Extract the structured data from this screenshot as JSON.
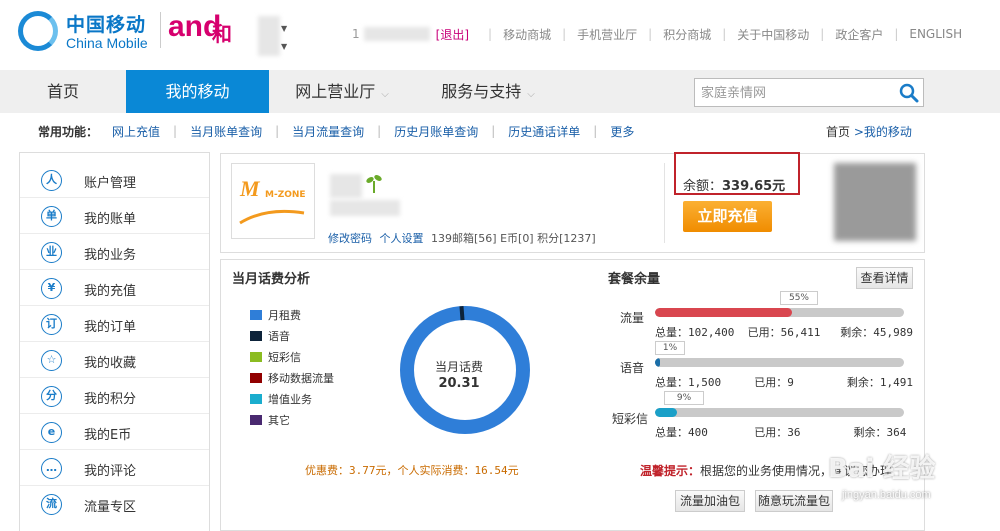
{
  "header": {
    "logo_cn": "中国移动",
    "logo_en": "China Mobile",
    "logo_and": "and",
    "logo_he": "和",
    "user_prefix": "1",
    "logout": "[退出]",
    "links": [
      "移动商城",
      "手机营业厅",
      "积分商城",
      "关于中国移动",
      "政企客户",
      "ENGLISH"
    ]
  },
  "nav": {
    "items": [
      "首页",
      "我的移动",
      "网上营业厅",
      "服务与支持"
    ],
    "active": "我的移动",
    "search_placeholder": "家庭亲情网"
  },
  "shortcuts": {
    "title": "常用功能：",
    "links": [
      "网上充值",
      "当月账单查询",
      "当月流量查询",
      "历史月账单查询",
      "历史通话详单",
      "更多"
    ]
  },
  "breadcrumb": {
    "home": "首页",
    "arrow": ">",
    "current": "我的移动"
  },
  "sidebar": {
    "items": [
      {
        "label": "账户管理",
        "icon": "person-icon",
        "glyph": "人"
      },
      {
        "label": "我的账单",
        "icon": "bill-icon",
        "glyph": "单"
      },
      {
        "label": "我的业务",
        "icon": "business-icon",
        "glyph": "业"
      },
      {
        "label": "我的充值",
        "icon": "yen-icon",
        "glyph": "¥"
      },
      {
        "label": "我的订单",
        "icon": "order-icon",
        "glyph": "订"
      },
      {
        "label": "我的收藏",
        "icon": "star-icon",
        "glyph": "☆"
      },
      {
        "label": "我的积分",
        "icon": "points-icon",
        "glyph": "分"
      },
      {
        "label": "我的E币",
        "icon": "ecoin-icon",
        "glyph": "e"
      },
      {
        "label": "我的评论",
        "icon": "comment-icon",
        "glyph": "…"
      },
      {
        "label": "流量专区",
        "icon": "traffic-icon",
        "glyph": "流"
      }
    ]
  },
  "account": {
    "logo_text": "M-ZONE",
    "links": [
      "修改密码",
      "个人设置"
    ],
    "stats": "139邮箱[56] E币[0] 积分[1237]",
    "balance_label": "余额：",
    "balance_value": "339.65元",
    "recharge": "立即充值"
  },
  "fee_analysis": {
    "title": "当月话费分析",
    "legend": [
      {
        "label": "月租费",
        "color": "#2f7ed8"
      },
      {
        "label": "语音",
        "color": "#0d233a"
      },
      {
        "label": "短彩信",
        "color": "#8bbc21"
      },
      {
        "label": "移动数据流量",
        "color": "#910000"
      },
      {
        "label": "增值业务",
        "color": "#1aadce"
      },
      {
        "label": "其它",
        "color": "#492970"
      }
    ],
    "center_label": "当月话费",
    "center_value": "20.31",
    "note": "优惠费：3.77元，个人实际消费：16.54元"
  },
  "package": {
    "title": "套餐余量",
    "detail_button": "查看详情",
    "rows": [
      {
        "label": "流量",
        "percent": "55%",
        "fill": 0.55,
        "color": "#d9464f",
        "total": "总量：102,400",
        "used": "已用：56,411",
        "remain": "剩余：45,989"
      },
      {
        "label": "语音",
        "percent": "1%",
        "fill": 0.01,
        "color": "#1a6ea8",
        "total": "总量：1,500",
        "used": "已用：9",
        "remain": "剩余：1,491"
      },
      {
        "label": "短彩信",
        "percent": "9%",
        "fill": 0.09,
        "color": "#1aa0c8",
        "total": "总量：400",
        "used": "已用：36",
        "remain": "剩余：364"
      }
    ],
    "tip_label": "温馨提示：",
    "tip_text": "根据您的业务使用情况，建议您办理",
    "buttons": [
      "流量加油包",
      "随意玩流量包"
    ]
  },
  "watermark": {
    "text": "Bai 经验",
    "url": "jingyan.baidu.com"
  }
}
